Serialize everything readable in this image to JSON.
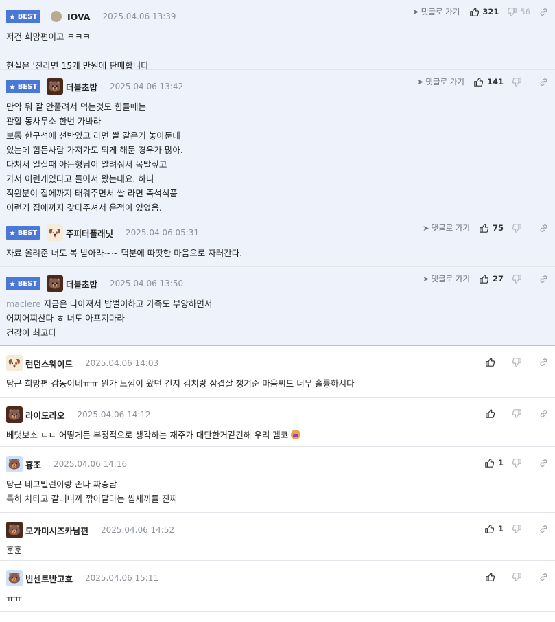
{
  "labels": {
    "best": "BEST",
    "reply": "댓글로 가기"
  },
  "colors": {
    "best_bg": "#eef2fb",
    "badge": "#4a78d6",
    "muted": "#8d939c"
  },
  "comments": [
    {
      "best": true,
      "nick": "IOVA",
      "time": "2025.04.06 13:39",
      "show_reply": true,
      "up": "321",
      "down": "56",
      "lines": [
        "저건 희망편이고 ㅋㅋㅋ",
        "",
        "현실은 '진라면 15개 만원에 판매합니다'"
      ]
    },
    {
      "best": true,
      "nick": "더블초밥",
      "time": "2025.04.06 13:42",
      "show_reply": true,
      "up": "141",
      "down": "",
      "lines": [
        "만약 뭐 잘 안풀려서 먹는것도 힘들때는",
        "관할 동사무소 한번 가봐라",
        "보통 한구석에 선반있고 라면 쌀 같은거 놓아둔데",
        "있는데 힘든사람 가져가도 되게 해둔 경우가 많아.",
        "다쳐서 일실때 아는형님이 알려줘서 목발짚고",
        "가서 이런게있다고 들어서 왔는데요. 하니",
        "직원분이 집에까지 태워주면서 쌀 라면 즉석식품",
        "이런거 집에까지 갖다주셔서 운적이 있었음."
      ]
    },
    {
      "best": true,
      "nick": "주피터플래닛",
      "time": "2025.04.06 05:31",
      "show_reply": true,
      "up": "75",
      "down": "",
      "lines": [
        "자료 올려준 너도 복 받아라~~ 덕분에 따땃한 마음으로 자러간다."
      ]
    },
    {
      "best": true,
      "nick": "더블초밥",
      "time": "2025.04.06 13:50",
      "show_reply": true,
      "up": "27",
      "down": "",
      "prefix": "maclere",
      "lines": [
        "지금은 나아져서 밥벌이하고 가족도 부양하면서",
        "어찌어찌산다 ㅎ 너도 아프지마라",
        "건강이 최고다"
      ]
    },
    {
      "best": false,
      "nick": "런던스웨이드",
      "time": "2025.04.06 14:03",
      "show_reply": false,
      "up": "",
      "down": "",
      "lines": [
        "당근 희망편 감동이네ㅠㅠ 뭔가 느낌이 왔던 건지 김치랑 삼겹살 챙겨준 마음씨도 너무 훌륭하시다"
      ]
    },
    {
      "best": false,
      "nick": "라이도라오",
      "time": "2025.04.06 14:12",
      "show_reply": false,
      "up": "",
      "down": "",
      "lines": [
        "베댓보소 ㄷㄷ 어떻게든 부정적으로 생각하는 재주가 대단한거같긴해 우리 펨코"
      ],
      "emoji": true
    },
    {
      "best": false,
      "nick": "흉조",
      "time": "2025.04.06 14:16",
      "show_reply": false,
      "up": "1",
      "down": "",
      "lines": [
        "당근 네고빌런이랑 존나 짜증남",
        "특히 차타고 갈테니까 깎아달라는 씹새끼들 진짜"
      ]
    },
    {
      "best": false,
      "nick": "모가미시즈카남편",
      "time": "2025.04.06 14:52",
      "show_reply": false,
      "up": "1",
      "down": "",
      "lines": [
        "훈훈"
      ]
    },
    {
      "best": false,
      "nick": "빈센트반고흐",
      "time": "2025.04.06 15:11",
      "show_reply": false,
      "up": "",
      "down": "",
      "lines": [
        "ㅠㅠ"
      ]
    }
  ]
}
